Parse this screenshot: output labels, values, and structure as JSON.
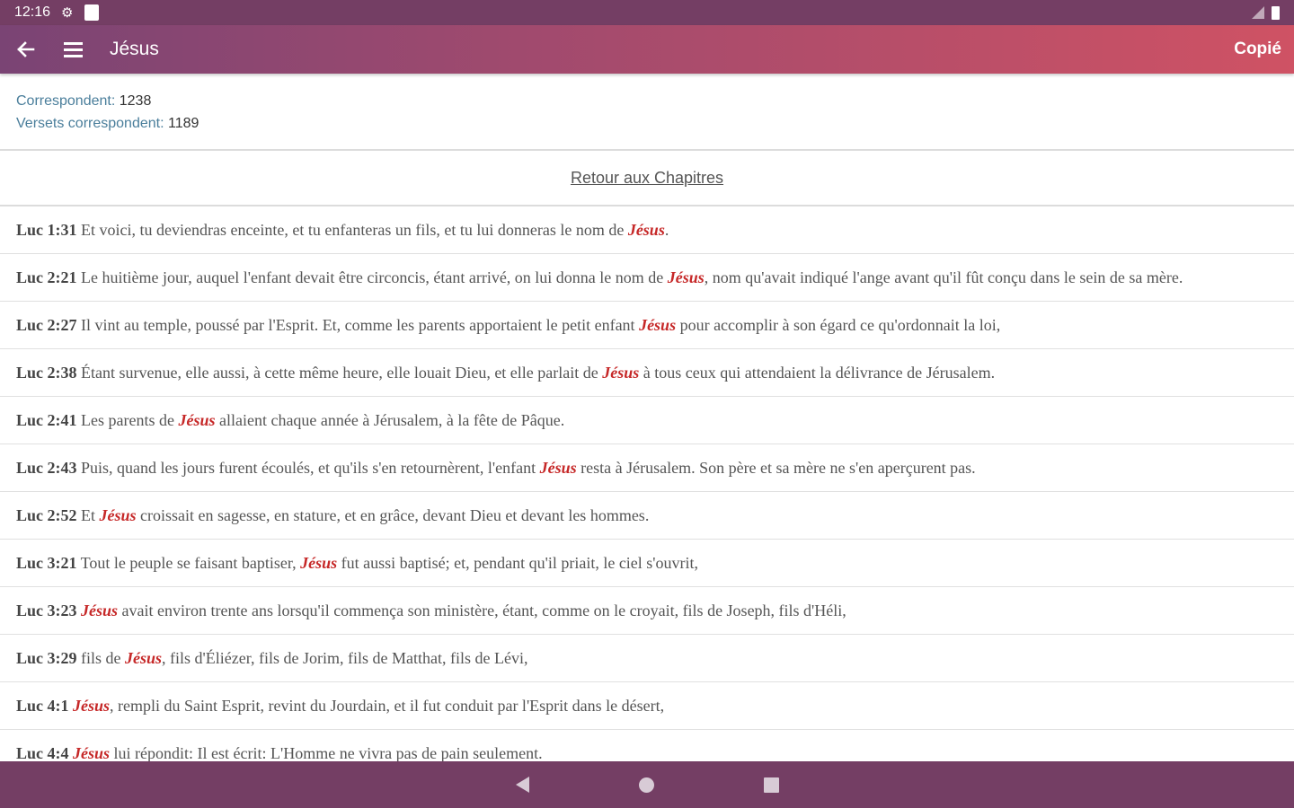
{
  "status_bar": {
    "time": "12:16",
    "icons": [
      "gear-icon",
      "notification-square-icon",
      "signal-icon",
      "battery-icon"
    ]
  },
  "app_bar": {
    "title": "Jésus",
    "copy_label": "Copié",
    "gradient_colors": [
      "#7a4474",
      "#cf5264"
    ]
  },
  "summary": {
    "matches_label": "Correspondent:",
    "matches_value": "1238",
    "verses_label": "Versets correspondent:",
    "verses_value": "1189"
  },
  "back_link": "Retour aux Chapitres",
  "highlight_color": "#c62828",
  "verses": [
    {
      "ref": "Luc 1:31",
      "before": " Et voici, tu deviendras enceinte, et tu enfanteras un fils, et tu lui donneras le nom de ",
      "word": "Jésus",
      "after": "."
    },
    {
      "ref": "Luc 2:21",
      "before": " Le huitième jour, auquel l'enfant devait être circoncis, étant arrivé, on lui donna le nom de ",
      "word": "Jésus",
      "after": ", nom qu'avait indiqué l'ange avant qu'il fût conçu dans le sein de sa mère."
    },
    {
      "ref": "Luc 2:27",
      "before": " Il vint au temple, poussé par l'Esprit. Et, comme les parents apportaient le petit enfant ",
      "word": "Jésus",
      "after": " pour accomplir à son égard ce qu'ordonnait la loi,"
    },
    {
      "ref": "Luc 2:38",
      "before": " Étant survenue, elle aussi, à cette même heure, elle louait Dieu, et elle parlait de ",
      "word": "Jésus",
      "after": " à tous ceux qui attendaient la délivrance de Jérusalem."
    },
    {
      "ref": "Luc 2:41",
      "before": " Les parents de ",
      "word": "Jésus",
      "after": " allaient chaque année à Jérusalem, à la fête de Pâque."
    },
    {
      "ref": "Luc 2:43",
      "before": " Puis, quand les jours furent écoulés, et qu'ils s'en retournèrent, l'enfant ",
      "word": "Jésus",
      "after": " resta à Jérusalem. Son père et sa mère ne s'en aperçurent pas."
    },
    {
      "ref": "Luc 2:52",
      "before": " Et ",
      "word": "Jésus",
      "after": " croissait en sagesse, en stature, et en grâce, devant Dieu et devant les hommes."
    },
    {
      "ref": "Luc 3:21",
      "before": " Tout le peuple se faisant baptiser, ",
      "word": "Jésus",
      "after": " fut aussi baptisé; et, pendant qu'il priait, le ciel s'ouvrit,"
    },
    {
      "ref": "Luc 3:23",
      "before": " ",
      "word": "Jésus",
      "after": " avait environ trente ans lorsqu'il commença son ministère, étant, comme on le croyait, fils de Joseph, fils d'Héli,"
    },
    {
      "ref": "Luc 3:29",
      "before": " fils de ",
      "word": "Jésus",
      "after": ", fils d'Éliézer, fils de Jorim, fils de Matthat, fils de Lévi,"
    },
    {
      "ref": "Luc 4:1",
      "before": " ",
      "word": "Jésus",
      "after": ", rempli du Saint Esprit, revint du Jourdain, et il fut conduit par l'Esprit dans le désert,"
    },
    {
      "ref": "Luc 4:4",
      "before": " ",
      "word": "Jésus",
      "after": " lui répondit: Il est écrit: L'Homme ne vivra pas de pain seulement."
    }
  ],
  "nav_bar": {
    "buttons": [
      "nav-back-icon",
      "nav-home-icon",
      "nav-recents-icon"
    ]
  }
}
